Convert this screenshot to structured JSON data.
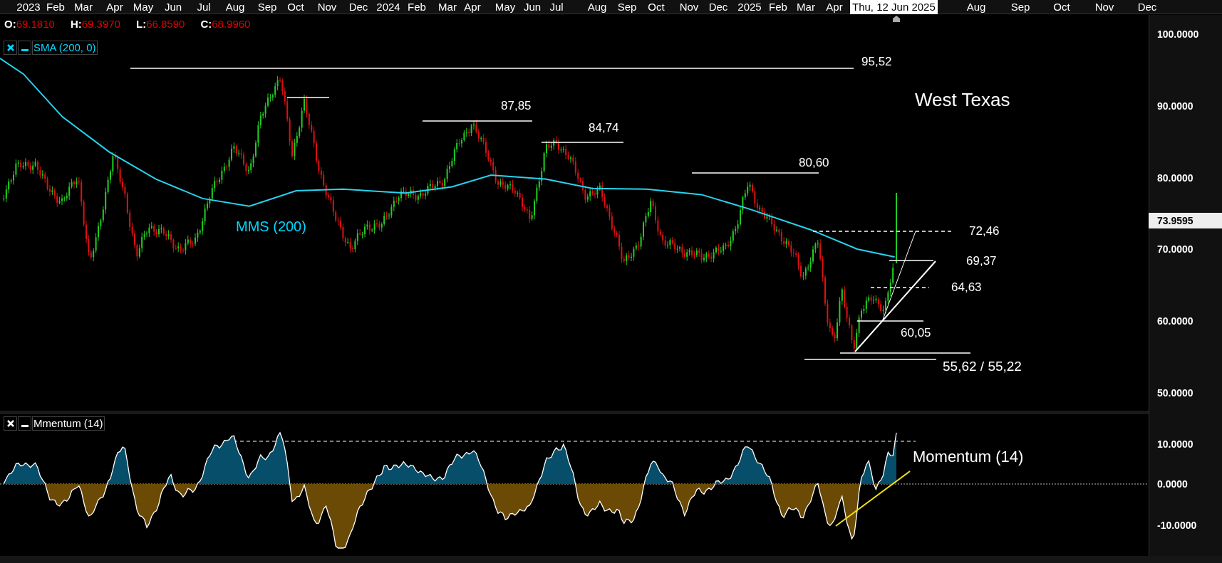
{
  "time_axis": {
    "labels": [
      "2023",
      "Feb",
      "Mar",
      "Apr",
      "May",
      "Jun",
      "Jul",
      "Aug",
      "Sep",
      "Oct",
      "Nov",
      "Dec",
      "2024",
      "Feb",
      "Mar",
      "Apr",
      "May",
      "Jun",
      "Jul",
      "Aug",
      "Sep",
      "Oct",
      "Nov",
      "Dec",
      "2025",
      "Feb",
      "Mar",
      "Apr",
      "Aug",
      "Sep",
      "Oct",
      "Nov",
      "Dec"
    ],
    "cursor_label": "Thu, 12 Jun 2025"
  },
  "ohlc": [
    {
      "label": "O:",
      "value": "69.1810"
    },
    {
      "label": "H:",
      "value": "69.3970"
    },
    {
      "label": "L:",
      "value": "66.8590"
    },
    {
      "label": "C:",
      "value": "68.9960"
    }
  ],
  "indicator_legend": {
    "label": "SMA (200, 0)"
  },
  "price_axis": {
    "labels": [
      "100.0000",
      "90.0000",
      "80.0000",
      "70.0000",
      "60.0000",
      "50.0000"
    ],
    "current_price": "73.9595"
  },
  "annotations": {
    "title": "West Texas",
    "sma_label": "MMS (200)",
    "levels": [
      "95,52",
      "87,85",
      "84,74",
      "80,60",
      "72,46",
      "69,37",
      "64,63",
      "60,05",
      "55,62 / 55,22"
    ]
  },
  "momentum_panel": {
    "legend": "Mmentum (14)",
    "label": "Momentum (14)",
    "axis_labels": [
      "10.0000",
      "0.0000",
      "-10.0000"
    ]
  }
}
